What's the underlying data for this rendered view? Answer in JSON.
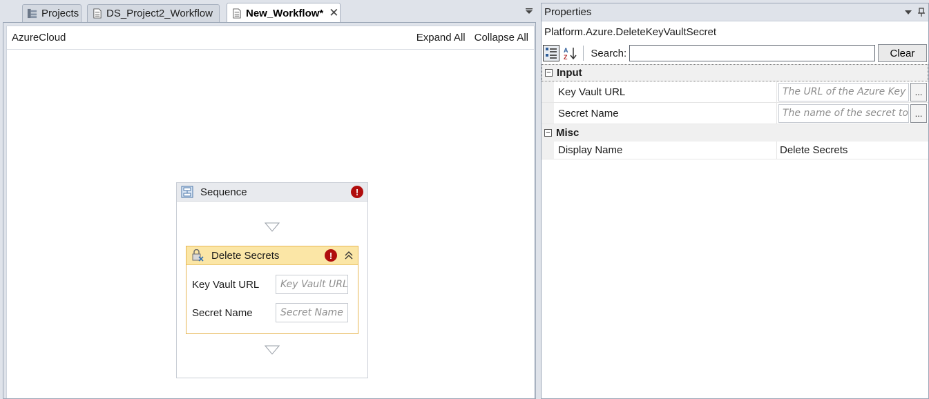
{
  "tabs": [
    {
      "label": "Projects",
      "icon": "project-explorer-icon",
      "active": false
    },
    {
      "label": "DS_Project2_Workflow",
      "icon": "workflow-document-icon",
      "active": false
    },
    {
      "label": "New_Workflow*",
      "icon": "workflow-document-icon",
      "active": true
    }
  ],
  "designer": {
    "breadcrumb": "AzureCloud",
    "expand_all": "Expand All",
    "collapse_all": "Collapse All",
    "sequence": {
      "title": "Sequence",
      "icon": "sequence-icon",
      "has_error": true,
      "activity": {
        "title": "Delete Secrets",
        "icon": "delete-secret-icon",
        "has_error": true,
        "fields": [
          {
            "label": "Key Vault URL",
            "placeholder": "Key Vault URL"
          },
          {
            "label": "Secret Name",
            "placeholder": "Secret Name"
          }
        ]
      }
    }
  },
  "properties": {
    "title": "Properties",
    "type_name": "Platform.Azure.DeleteKeyVaultSecret",
    "search_label": "Search:",
    "search_value": "",
    "clear_label": "Clear",
    "categories": [
      {
        "name": "Input",
        "rows": [
          {
            "name": "Key Vault URL",
            "placeholder": "The URL of the Azure Key Vault"
          },
          {
            "name": "Secret Name",
            "placeholder": "The name of the secret to remove"
          }
        ]
      },
      {
        "name": "Misc",
        "rows": [
          {
            "name": "Display Name",
            "value": "Delete Secrets"
          }
        ]
      }
    ]
  },
  "colors": {
    "error": "#b00d0d",
    "activity_header": "#fbe6a6",
    "activity_border": "#e7b652"
  }
}
